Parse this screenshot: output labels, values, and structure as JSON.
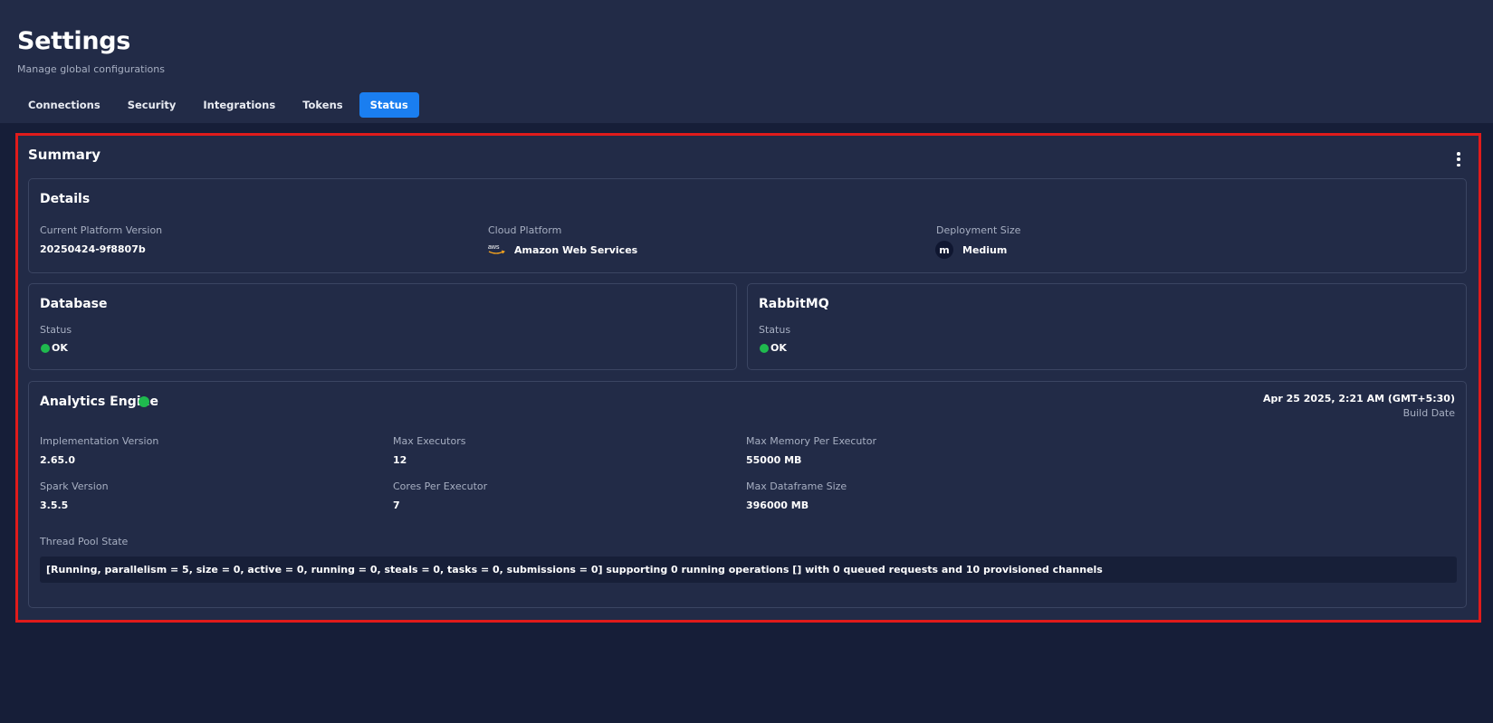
{
  "header": {
    "title": "Settings",
    "subtitle": "Manage global configurations"
  },
  "tabs": [
    {
      "label": "Connections",
      "active": false
    },
    {
      "label": "Security",
      "active": false
    },
    {
      "label": "Integrations",
      "active": false
    },
    {
      "label": "Tokens",
      "active": false
    },
    {
      "label": "Status",
      "active": true
    }
  ],
  "summary": {
    "title": "Summary",
    "menu_icon": "vertical-dots-icon"
  },
  "details": {
    "title": "Details",
    "platform_version_label": "Current Platform Version",
    "platform_version_value": "20250424-9f8807b",
    "cloud_platform_label": "Cloud Platform",
    "cloud_platform_value": "Amazon Web Services",
    "cloud_platform_icon": "aws-icon",
    "deployment_size_label": "Deployment Size",
    "deployment_size_value": "Medium",
    "deployment_size_icon": "m",
    "deployment_size_icon_name": "medium-size-icon"
  },
  "database": {
    "title": "Database",
    "status_label": "Status",
    "status_value": "OK",
    "status_color": "#1fba4e"
  },
  "rabbitmq": {
    "title": "RabbitMQ",
    "status_label": "Status",
    "status_value": "OK",
    "status_color": "#1fba4e"
  },
  "analytics_engine": {
    "title": "Analytics Engine",
    "status_color": "#1fba4e",
    "build_date_value": "Apr 25 2025, 2:21 AM (GMT+5:30)",
    "build_date_label": "Build Date",
    "implementation_version_label": "Implementation Version",
    "implementation_version_value": "2.65.0",
    "max_executors_label": "Max Executors",
    "max_executors_value": "12",
    "max_memory_label": "Max Memory Per Executor",
    "max_memory_value": "55000 MB",
    "spark_version_label": "Spark Version",
    "spark_version_value": "3.5.5",
    "cores_label": "Cores Per Executor",
    "cores_value": "7",
    "max_dataframe_label": "Max Dataframe Size",
    "max_dataframe_value": "396000 MB",
    "thread_pool_label": "Thread Pool State",
    "thread_pool_value": "[Running, parallelism = 5, size = 0, active = 0, running = 0, steals = 0, tasks = 0, submissions = 0] supporting 0 running operations [] with 0 queued requests and 10 provisioned channels"
  },
  "colors": {
    "accent": "#1a7ef0",
    "highlight_border": "#e01b1b",
    "ok": "#1fba4e"
  }
}
